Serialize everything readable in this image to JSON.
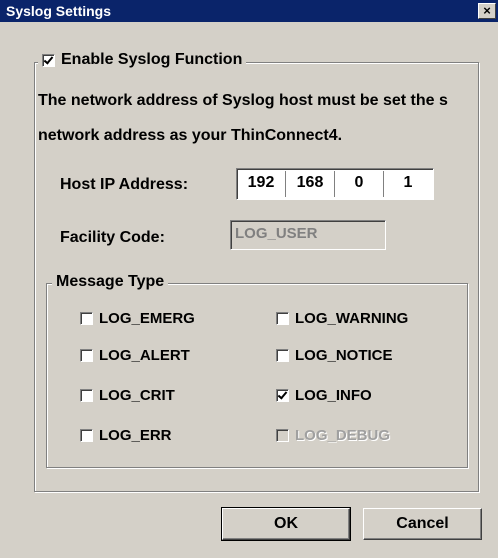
{
  "window": {
    "title": "Syslog Settings",
    "close_glyph": "×"
  },
  "enable": {
    "label": "Enable Syslog Function",
    "checked": true
  },
  "description": {
    "line1": "The network address of Syslog host must be set the s",
    "line2": "network address as your ThinConnect4."
  },
  "host_ip": {
    "label": "Host IP Address:",
    "octets": [
      "192",
      "168",
      "0",
      "1"
    ]
  },
  "facility": {
    "label": "Facility Code:",
    "value": "LOG_USER"
  },
  "message_type": {
    "legend": "Message Type",
    "items": [
      {
        "label": "LOG_EMERG",
        "checked": false,
        "disabled": false
      },
      {
        "label": "LOG_WARNING",
        "checked": false,
        "disabled": false
      },
      {
        "label": "LOG_ALERT",
        "checked": false,
        "disabled": false
      },
      {
        "label": "LOG_NOTICE",
        "checked": false,
        "disabled": false
      },
      {
        "label": "LOG_CRIT",
        "checked": false,
        "disabled": false
      },
      {
        "label": "LOG_INFO",
        "checked": true,
        "disabled": false
      },
      {
        "label": "LOG_ERR",
        "checked": false,
        "disabled": false
      },
      {
        "label": "LOG_DEBUG",
        "checked": false,
        "disabled": true
      }
    ]
  },
  "buttons": {
    "ok": "OK",
    "cancel": "Cancel"
  }
}
